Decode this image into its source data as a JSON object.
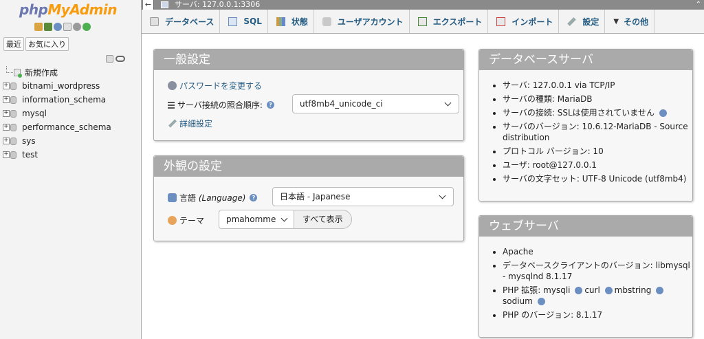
{
  "nav": {
    "logo": {
      "php": "php",
      "my": "My",
      "admin": "Admin"
    },
    "tabs": [
      "最近",
      "お気に入り"
    ],
    "tree": [
      {
        "label": "新規作成",
        "type": "new"
      },
      {
        "label": "bitnami_wordpress",
        "type": "db"
      },
      {
        "label": "information_schema",
        "type": "db"
      },
      {
        "label": "mysql",
        "type": "db"
      },
      {
        "label": "performance_schema",
        "type": "db"
      },
      {
        "label": "sys",
        "type": "db"
      },
      {
        "label": "test",
        "type": "db"
      }
    ]
  },
  "topbar": {
    "server": "サーバ: 127.0.0.1:3306"
  },
  "menu": [
    {
      "label": "データベース",
      "icon": "database-icon"
    },
    {
      "label": "SQL",
      "icon": "sql-icon"
    },
    {
      "label": "状態",
      "icon": "status-icon"
    },
    {
      "label": "ユーザアカウント",
      "icon": "users-icon"
    },
    {
      "label": "エクスポート",
      "icon": "export-icon"
    },
    {
      "label": "インポート",
      "icon": "import-icon"
    },
    {
      "label": "設定",
      "icon": "settings-icon"
    },
    {
      "label": "その他",
      "icon": "chevron-down-icon"
    }
  ],
  "general": {
    "title": "一般設定",
    "change_password": "パスワードを変更する",
    "collation_label": "サーバ接続の照合順序:",
    "collation_value": "utf8mb4_unicode_ci",
    "more_settings": "詳細設定"
  },
  "appearance": {
    "title": "外観の設定",
    "language_label_prefix": "言語 ",
    "language_label_italic": "(Language)",
    "language_value": "日本語 - Japanese",
    "theme_label": "テーマ",
    "theme_value": "pmahomme",
    "show_all": "すべて表示"
  },
  "dbserver": {
    "title": "データベースサーバ",
    "items": [
      "サーバ: 127.0.0.1 via TCP/IP",
      "サーバの種類: MariaDB",
      "サーバの接続: SSLは使用されていません",
      "サーバのバージョン: 10.6.12-MariaDB - Source distribution",
      "プロトコル バージョン: 10",
      "ユーザ: root@127.0.0.1",
      "サーバの文字セット: UTF-8 Unicode (utf8mb4)"
    ]
  },
  "webserver": {
    "title": "ウェブサーバ",
    "items": [
      "Apache",
      "データベースクライアントのバージョン: libmysql - mysqlnd 8.1.17",
      "PHP 拡張: mysqli",
      "PHP のバージョン: 8.1.17"
    ],
    "extensions": [
      "curl",
      "mbstring",
      "sodium"
    ]
  }
}
